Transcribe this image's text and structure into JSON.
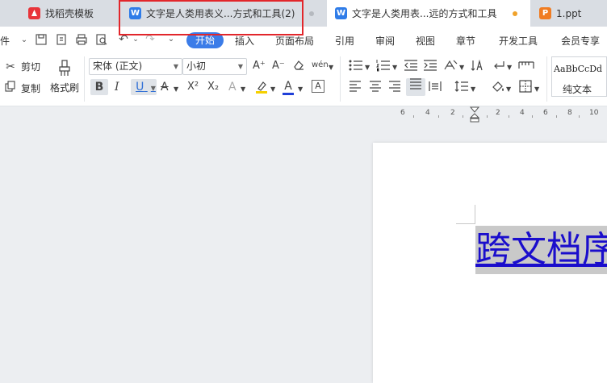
{
  "tabs": [
    {
      "label": "找稻壳模板",
      "icon": "docer-logo-icon",
      "color": "#e8343a"
    },
    {
      "label": "文字是人类用表义...方式和工具(2)",
      "icon": "wps-writer-icon",
      "color": "#2f7ce8"
    },
    {
      "label": "文字是人类用表...远的方式和工具",
      "icon": "wps-writer-icon",
      "color": "#2f7ce8"
    },
    {
      "label": "1.ppt",
      "icon": "wps-presentation-icon",
      "color": "#f07c22"
    }
  ],
  "tab_icon_letters": {
    "writer": "W",
    "presentation": "P"
  },
  "highlight_color": "#e2262b",
  "accent_color": "#3b7ce8",
  "menu": {
    "file_partial": "件",
    "items": [
      "开始",
      "插入",
      "页面布局",
      "引用",
      "审阅",
      "视图",
      "章节",
      "开发工具",
      "会员专享"
    ],
    "active": "开始"
  },
  "ribbon": {
    "cut_label": "剪切",
    "copy_label": "复制",
    "format_painter_label": "格式刷",
    "font_name": "宋体 (正文)",
    "font_size": "小初",
    "style_sample": "AaBbCcDd",
    "style_name": "纯文本",
    "glyphs": {
      "grow": "A⁺",
      "shrink": "A⁻",
      "phonetic": "wén",
      "bold": "B",
      "italic": "I",
      "underline": "U",
      "strikethrough": "A",
      "superscript": "X²",
      "subscript": "X₂",
      "text_effect": "A",
      "font_color": "A",
      "char_border": "A"
    }
  },
  "ruler": {
    "numbers": [
      "6",
      "4",
      "2",
      "2",
      "4",
      "6",
      "8",
      "10"
    ]
  },
  "document": {
    "text": "跨文档序"
  }
}
